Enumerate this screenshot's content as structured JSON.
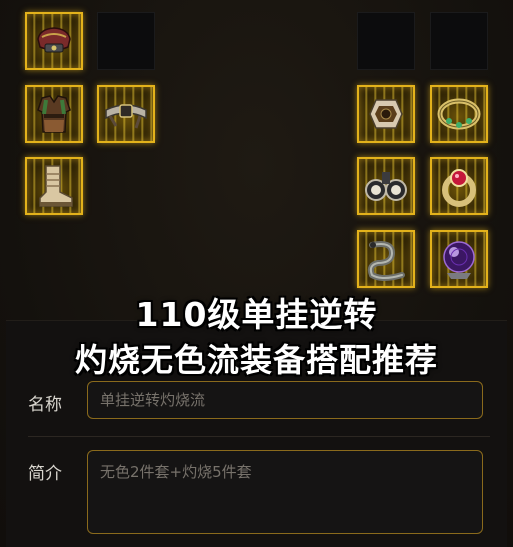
{
  "title": {
    "line1": "110级单挂逆转",
    "line2": "灼烧无色流装备搭配推荐"
  },
  "form": {
    "name_label": "名称",
    "name_value": "单挂逆转灼烧流",
    "desc_label": "简介",
    "desc_value": "无色2件套+灼烧5件套"
  },
  "equipment": {
    "left": [
      "shoulder-armor-icon",
      "empty",
      "coat-armor-icon",
      "belt-icon",
      "boots-icon"
    ],
    "right": [
      "empty",
      "empty",
      "bracelet-icon",
      "necklace-icon",
      "goggles-icon",
      "ring-icon",
      "serpent-charm-icon",
      "dark-orb-icon"
    ]
  },
  "colors": {
    "slot_border": "#e3b21b",
    "field_border": "#8a6a1c",
    "background": "#15120e"
  }
}
